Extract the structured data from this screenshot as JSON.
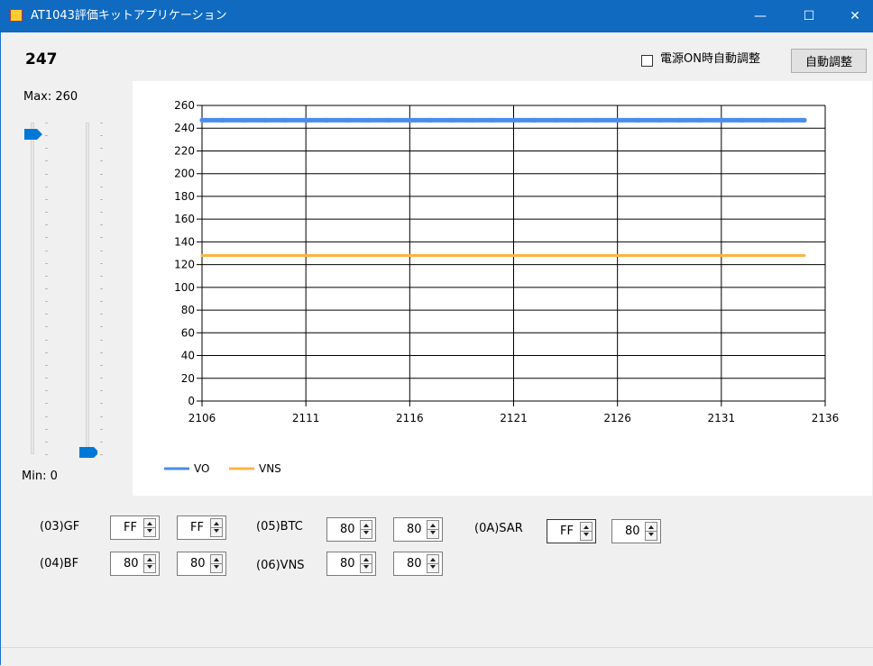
{
  "window": {
    "title": "AT1043評価キットアプリケーション",
    "minimize": "—",
    "maximize": "☐",
    "close": "✕"
  },
  "current_value": "247",
  "auto_on_power": {
    "label": "電源ON時自動調整",
    "checked": false
  },
  "auto_adjust_button": "自動調整",
  "slider": {
    "max_label": "Max: 260",
    "min_label": "Min: 0",
    "max": 260,
    "min": 0,
    "left_value": 247,
    "right_value": 0
  },
  "colors": {
    "vo": "#4a8cef",
    "vns": "#fcb445",
    "titlebar": "#0f6ac0",
    "thumb": "#0078d7"
  },
  "chart_data": {
    "type": "line",
    "x_ticks": [
      2106,
      2111,
      2116,
      2121,
      2126,
      2131,
      2136
    ],
    "y_ticks": [
      0,
      20,
      40,
      60,
      80,
      100,
      120,
      140,
      160,
      180,
      200,
      220,
      240,
      260
    ],
    "xlim": [
      2106,
      2136
    ],
    "ylim": [
      0,
      260
    ],
    "grid": true,
    "legend_position": "bottom-left",
    "series": [
      {
        "name": "VO",
        "x": [
          2106,
          2107,
          2108,
          2109,
          2110,
          2111,
          2112,
          2113,
          2114,
          2115,
          2116,
          2117,
          2118,
          2119,
          2120,
          2121,
          2122,
          2123,
          2124,
          2125,
          2126,
          2127,
          2128,
          2129,
          2130,
          2131,
          2132,
          2133,
          2134,
          2135
        ],
        "values": [
          247,
          247,
          247,
          247,
          247,
          247,
          247,
          247,
          247,
          247,
          247,
          247,
          247,
          247,
          247,
          247,
          247,
          247,
          247,
          247,
          247,
          247,
          247,
          247,
          247,
          247,
          247,
          247,
          247,
          247
        ]
      },
      {
        "name": "VNS",
        "x": [
          2106,
          2107,
          2108,
          2109,
          2110,
          2111,
          2112,
          2113,
          2114,
          2115,
          2116,
          2117,
          2118,
          2119,
          2120,
          2121,
          2122,
          2123,
          2124,
          2125,
          2126,
          2127,
          2128,
          2129,
          2130,
          2131,
          2132,
          2133,
          2134,
          2135
        ],
        "values": [
          128,
          128,
          128,
          128,
          128,
          128,
          128,
          128,
          128,
          128,
          128,
          128,
          128,
          128,
          128,
          128,
          128,
          128,
          128,
          128,
          128,
          128,
          128,
          128,
          128,
          128,
          128,
          128,
          128,
          128
        ]
      }
    ]
  },
  "registers": {
    "gf": {
      "label": "(03)GF",
      "v1": "FF",
      "v2": "FF"
    },
    "bf": {
      "label": "(04)BF",
      "v1": "80",
      "v2": "80"
    },
    "btc": {
      "label": "(05)BTC",
      "v1": "80",
      "v2": "80"
    },
    "vns": {
      "label": "(06)VNS",
      "v1": "80",
      "v2": "80"
    },
    "sar": {
      "label": "(0A)SAR",
      "v1": "FF",
      "v2": "80"
    }
  }
}
